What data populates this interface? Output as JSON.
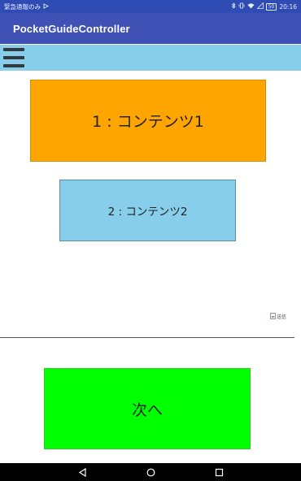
{
  "status_bar": {
    "left_text": "緊急通報のみ",
    "time": "20:16",
    "battery": "50",
    "icons": [
      "usb-debug-icon",
      "bluetooth-icon",
      "vibrate-icon",
      "wifi-icon",
      "signal-icon",
      "battery-icon"
    ]
  },
  "app_bar": {
    "title": "PocketGuideController"
  },
  "menu": {
    "icon": "hamburger-menu-icon",
    "color": "#87ceeb"
  },
  "contents": [
    {
      "label": "1 : コンテンツ1",
      "color": "#ffa500"
    },
    {
      "label": "2 : コンテンツ2",
      "color": "#87ceeb"
    }
  ],
  "image_alt": "送信",
  "next_button": {
    "label": "次へ",
    "color": "#00ff00"
  },
  "nav_bar": {
    "icons": [
      "back-icon",
      "home-icon",
      "recent-apps-icon"
    ]
  },
  "colors": {
    "primary": "#3f51b5",
    "primary_dark": "#2f4bb4"
  }
}
